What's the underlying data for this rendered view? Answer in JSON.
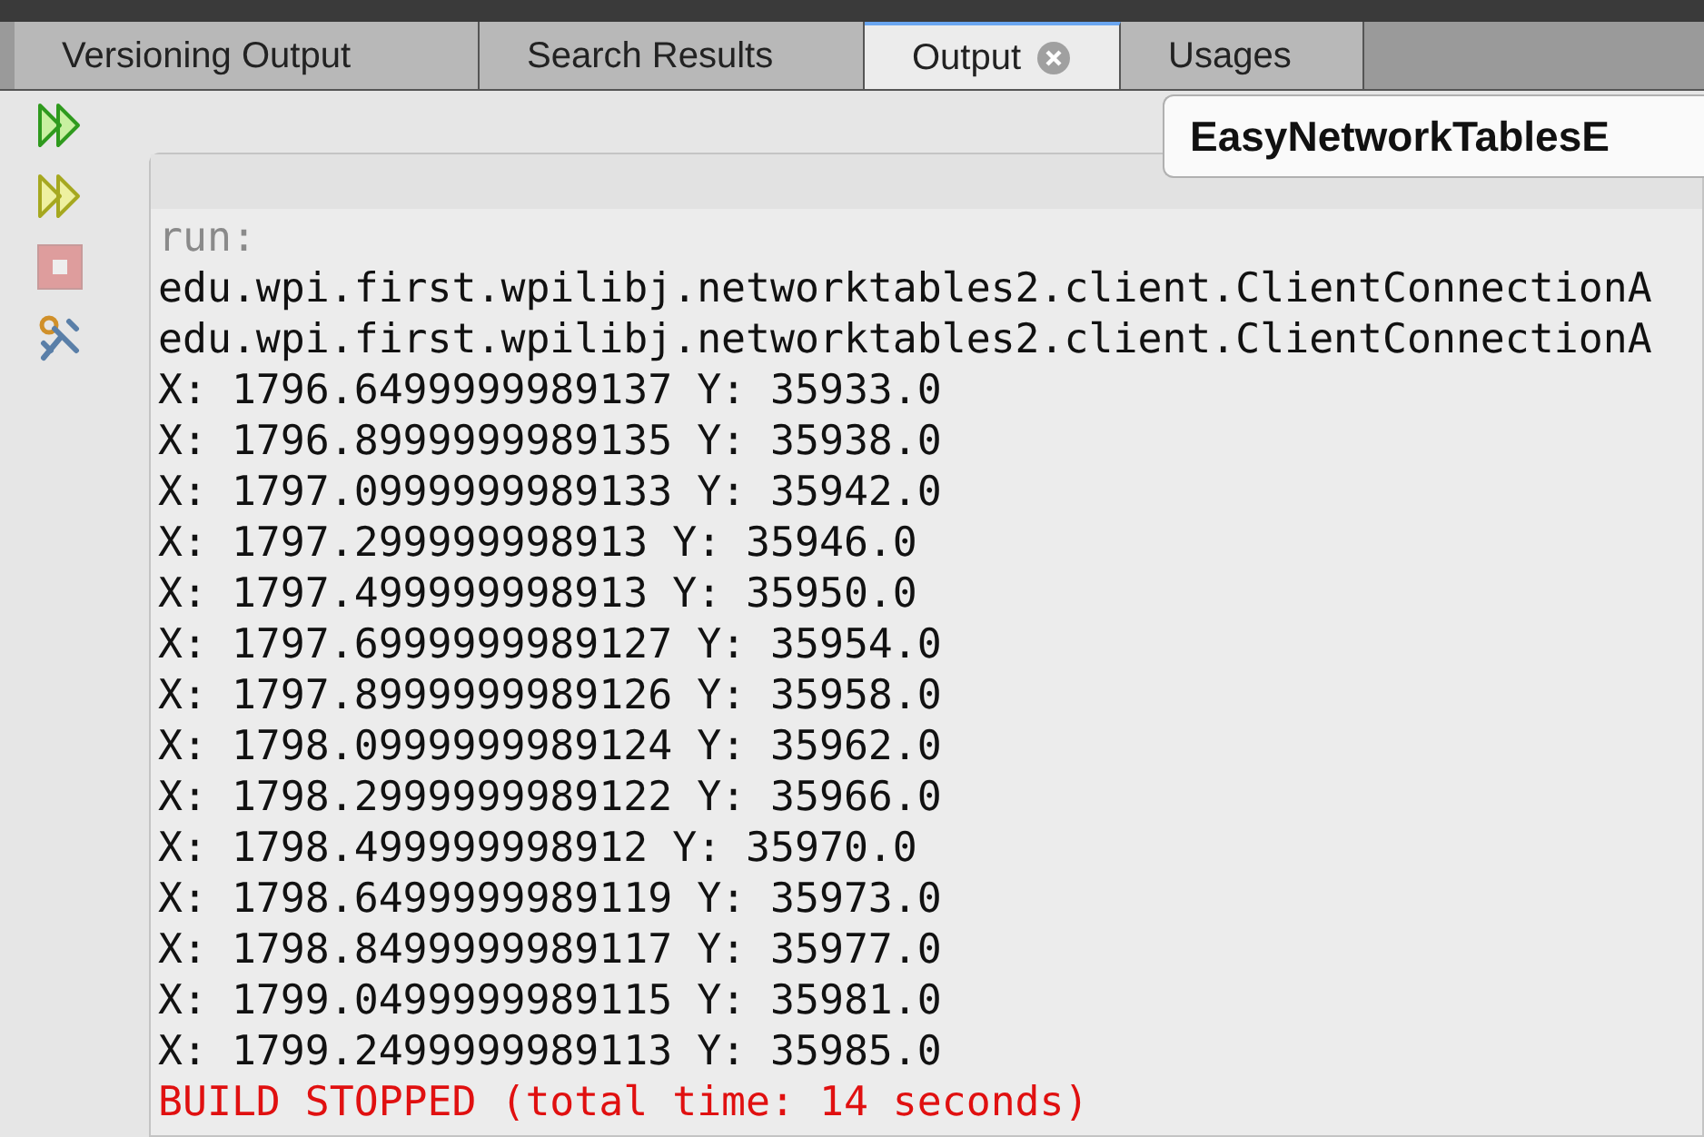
{
  "tabs": [
    {
      "label": "Versioning Output",
      "selected": false,
      "closable": false
    },
    {
      "label": "Search Results",
      "selected": false,
      "closable": false
    },
    {
      "label": "Output",
      "selected": true,
      "closable": true
    },
    {
      "label": "Usages",
      "selected": false,
      "closable": false
    }
  ],
  "toolbar": [
    {
      "kind": "rerun",
      "disabled": false
    },
    {
      "kind": "rerun-with-options",
      "disabled": false
    },
    {
      "kind": "stop",
      "disabled": true
    },
    {
      "kind": "settings",
      "disabled": false
    }
  ],
  "output_tab": {
    "label": "EasyNetworkTablesE"
  },
  "output_lines": [
    {
      "kind": "info",
      "text": "run:"
    },
    {
      "kind": "normal",
      "text": "edu.wpi.first.wpilibj.networktables2.client.ClientConnectionA"
    },
    {
      "kind": "normal",
      "text": "edu.wpi.first.wpilibj.networktables2.client.ClientConnectionA"
    },
    {
      "kind": "normal",
      "text": "X: 1796.6499999989137 Y: 35933.0"
    },
    {
      "kind": "normal",
      "text": "X: 1796.8999999989135 Y: 35938.0"
    },
    {
      "kind": "normal",
      "text": "X: 1797.0999999989133 Y: 35942.0"
    },
    {
      "kind": "normal",
      "text": "X: 1797.299999998913 Y: 35946.0"
    },
    {
      "kind": "normal",
      "text": "X: 1797.499999998913 Y: 35950.0"
    },
    {
      "kind": "normal",
      "text": "X: 1797.6999999989127 Y: 35954.0"
    },
    {
      "kind": "normal",
      "text": "X: 1797.8999999989126 Y: 35958.0"
    },
    {
      "kind": "normal",
      "text": "X: 1798.0999999989124 Y: 35962.0"
    },
    {
      "kind": "normal",
      "text": "X: 1798.2999999989122 Y: 35966.0"
    },
    {
      "kind": "normal",
      "text": "X: 1798.499999998912 Y: 35970.0"
    },
    {
      "kind": "normal",
      "text": "X: 1798.6499999989119 Y: 35973.0"
    },
    {
      "kind": "normal",
      "text": "X: 1798.8499999989117 Y: 35977.0"
    },
    {
      "kind": "normal",
      "text": "X: 1799.0499999989115 Y: 35981.0"
    },
    {
      "kind": "normal",
      "text": "X: 1799.2499999989113 Y: 35985.0"
    },
    {
      "kind": "error",
      "text": "BUILD STOPPED (total time: 14 seconds)"
    }
  ]
}
